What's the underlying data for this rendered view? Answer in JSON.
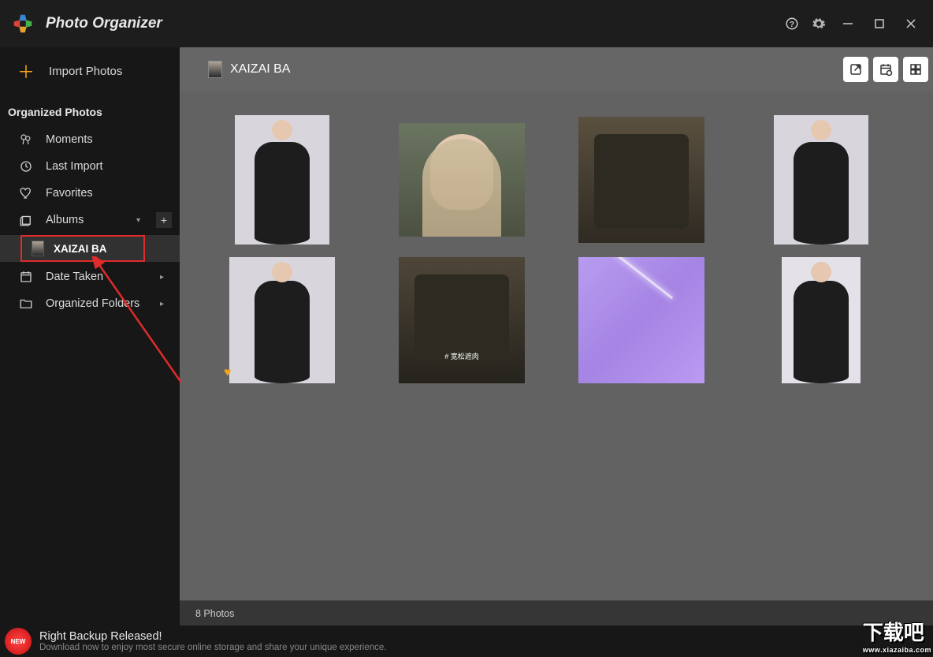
{
  "app": {
    "title": "Photo Organizer"
  },
  "sidebar": {
    "import_label": "Import Photos",
    "section_title": "Organized Photos",
    "moments": "Moments",
    "last_import": "Last Import",
    "favorites": "Favorites",
    "albums": "Albums",
    "selected_album": "XAIZAI BA",
    "date_taken": "Date Taken",
    "organized_folders": "Organized Folders"
  },
  "content": {
    "header_title": "XAIZAI BA",
    "photo_count_label": "8 Photos",
    "photos": [
      {
        "favorited": false
      },
      {
        "favorited": false
      },
      {
        "favorited": false
      },
      {
        "favorited": false
      },
      {
        "favorited": true
      },
      {
        "favorited": false,
        "caption": "# 宽松遮肉"
      },
      {
        "favorited": false
      },
      {
        "favorited": false
      }
    ]
  },
  "footer": {
    "badge": "NEW",
    "title": "Right Backup Released!",
    "subtitle": "Download now to enjoy most secure online storage and share your unique experience."
  },
  "watermark": {
    "main": "下载吧",
    "url": "www.xiazaiba.com"
  }
}
